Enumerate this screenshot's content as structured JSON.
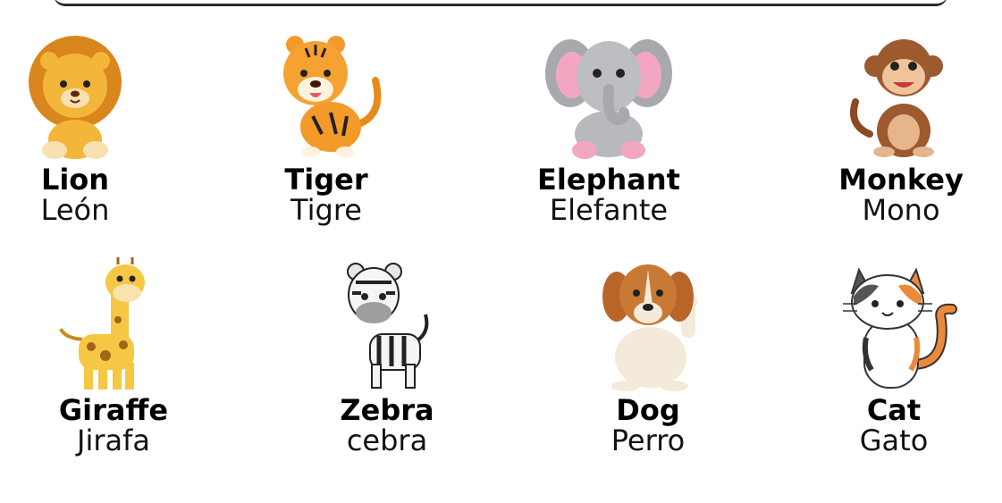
{
  "animals": [
    {
      "english": "Lion",
      "spanish": "León",
      "icon": "lion-icon"
    },
    {
      "english": "Tiger",
      "spanish": "Tigre",
      "icon": "tiger-icon"
    },
    {
      "english": "Elephant",
      "spanish": "Elefante",
      "icon": "elephant-icon"
    },
    {
      "english": "Monkey",
      "spanish": "Mono",
      "icon": "monkey-icon"
    },
    {
      "english": "Giraffe",
      "spanish": "Jirafa",
      "icon": "giraffe-icon"
    },
    {
      "english": "Zebra",
      "spanish": "cebra",
      "icon": "zebra-icon"
    },
    {
      "english": "Dog",
      "spanish": "Perro",
      "icon": "dog-icon"
    },
    {
      "english": "Cat",
      "spanish": "Gato",
      "icon": "cat-icon"
    }
  ]
}
